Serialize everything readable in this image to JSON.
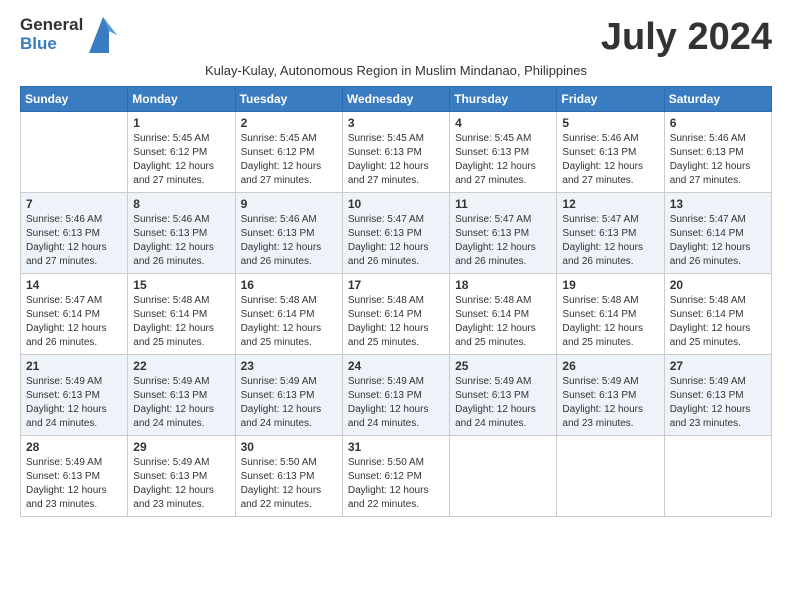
{
  "header": {
    "logo_general": "General",
    "logo_blue": "Blue",
    "month_year": "July 2024",
    "subtitle": "Kulay-Kulay, Autonomous Region in Muslim Mindanao, Philippines"
  },
  "weekdays": [
    "Sunday",
    "Monday",
    "Tuesday",
    "Wednesday",
    "Thursday",
    "Friday",
    "Saturday"
  ],
  "weeks": [
    [
      {
        "day": "",
        "info": ""
      },
      {
        "day": "1",
        "info": "Sunrise: 5:45 AM\nSunset: 6:12 PM\nDaylight: 12 hours\nand 27 minutes."
      },
      {
        "day": "2",
        "info": "Sunrise: 5:45 AM\nSunset: 6:12 PM\nDaylight: 12 hours\nand 27 minutes."
      },
      {
        "day": "3",
        "info": "Sunrise: 5:45 AM\nSunset: 6:13 PM\nDaylight: 12 hours\nand 27 minutes."
      },
      {
        "day": "4",
        "info": "Sunrise: 5:45 AM\nSunset: 6:13 PM\nDaylight: 12 hours\nand 27 minutes."
      },
      {
        "day": "5",
        "info": "Sunrise: 5:46 AM\nSunset: 6:13 PM\nDaylight: 12 hours\nand 27 minutes."
      },
      {
        "day": "6",
        "info": "Sunrise: 5:46 AM\nSunset: 6:13 PM\nDaylight: 12 hours\nand 27 minutes."
      }
    ],
    [
      {
        "day": "7",
        "info": "Sunrise: 5:46 AM\nSunset: 6:13 PM\nDaylight: 12 hours\nand 27 minutes."
      },
      {
        "day": "8",
        "info": "Sunrise: 5:46 AM\nSunset: 6:13 PM\nDaylight: 12 hours\nand 26 minutes."
      },
      {
        "day": "9",
        "info": "Sunrise: 5:46 AM\nSunset: 6:13 PM\nDaylight: 12 hours\nand 26 minutes."
      },
      {
        "day": "10",
        "info": "Sunrise: 5:47 AM\nSunset: 6:13 PM\nDaylight: 12 hours\nand 26 minutes."
      },
      {
        "day": "11",
        "info": "Sunrise: 5:47 AM\nSunset: 6:13 PM\nDaylight: 12 hours\nand 26 minutes."
      },
      {
        "day": "12",
        "info": "Sunrise: 5:47 AM\nSunset: 6:13 PM\nDaylight: 12 hours\nand 26 minutes."
      },
      {
        "day": "13",
        "info": "Sunrise: 5:47 AM\nSunset: 6:14 PM\nDaylight: 12 hours\nand 26 minutes."
      }
    ],
    [
      {
        "day": "14",
        "info": "Sunrise: 5:47 AM\nSunset: 6:14 PM\nDaylight: 12 hours\nand 26 minutes."
      },
      {
        "day": "15",
        "info": "Sunrise: 5:48 AM\nSunset: 6:14 PM\nDaylight: 12 hours\nand 25 minutes."
      },
      {
        "day": "16",
        "info": "Sunrise: 5:48 AM\nSunset: 6:14 PM\nDaylight: 12 hours\nand 25 minutes."
      },
      {
        "day": "17",
        "info": "Sunrise: 5:48 AM\nSunset: 6:14 PM\nDaylight: 12 hours\nand 25 minutes."
      },
      {
        "day": "18",
        "info": "Sunrise: 5:48 AM\nSunset: 6:14 PM\nDaylight: 12 hours\nand 25 minutes."
      },
      {
        "day": "19",
        "info": "Sunrise: 5:48 AM\nSunset: 6:14 PM\nDaylight: 12 hours\nand 25 minutes."
      },
      {
        "day": "20",
        "info": "Sunrise: 5:48 AM\nSunset: 6:14 PM\nDaylight: 12 hours\nand 25 minutes."
      }
    ],
    [
      {
        "day": "21",
        "info": "Sunrise: 5:49 AM\nSunset: 6:13 PM\nDaylight: 12 hours\nand 24 minutes."
      },
      {
        "day": "22",
        "info": "Sunrise: 5:49 AM\nSunset: 6:13 PM\nDaylight: 12 hours\nand 24 minutes."
      },
      {
        "day": "23",
        "info": "Sunrise: 5:49 AM\nSunset: 6:13 PM\nDaylight: 12 hours\nand 24 minutes."
      },
      {
        "day": "24",
        "info": "Sunrise: 5:49 AM\nSunset: 6:13 PM\nDaylight: 12 hours\nand 24 minutes."
      },
      {
        "day": "25",
        "info": "Sunrise: 5:49 AM\nSunset: 6:13 PM\nDaylight: 12 hours\nand 24 minutes."
      },
      {
        "day": "26",
        "info": "Sunrise: 5:49 AM\nSunset: 6:13 PM\nDaylight: 12 hours\nand 23 minutes."
      },
      {
        "day": "27",
        "info": "Sunrise: 5:49 AM\nSunset: 6:13 PM\nDaylight: 12 hours\nand 23 minutes."
      }
    ],
    [
      {
        "day": "28",
        "info": "Sunrise: 5:49 AM\nSunset: 6:13 PM\nDaylight: 12 hours\nand 23 minutes."
      },
      {
        "day": "29",
        "info": "Sunrise: 5:49 AM\nSunset: 6:13 PM\nDaylight: 12 hours\nand 23 minutes."
      },
      {
        "day": "30",
        "info": "Sunrise: 5:50 AM\nSunset: 6:13 PM\nDaylight: 12 hours\nand 22 minutes."
      },
      {
        "day": "31",
        "info": "Sunrise: 5:50 AM\nSunset: 6:12 PM\nDaylight: 12 hours\nand 22 minutes."
      },
      {
        "day": "",
        "info": ""
      },
      {
        "day": "",
        "info": ""
      },
      {
        "day": "",
        "info": ""
      }
    ]
  ]
}
